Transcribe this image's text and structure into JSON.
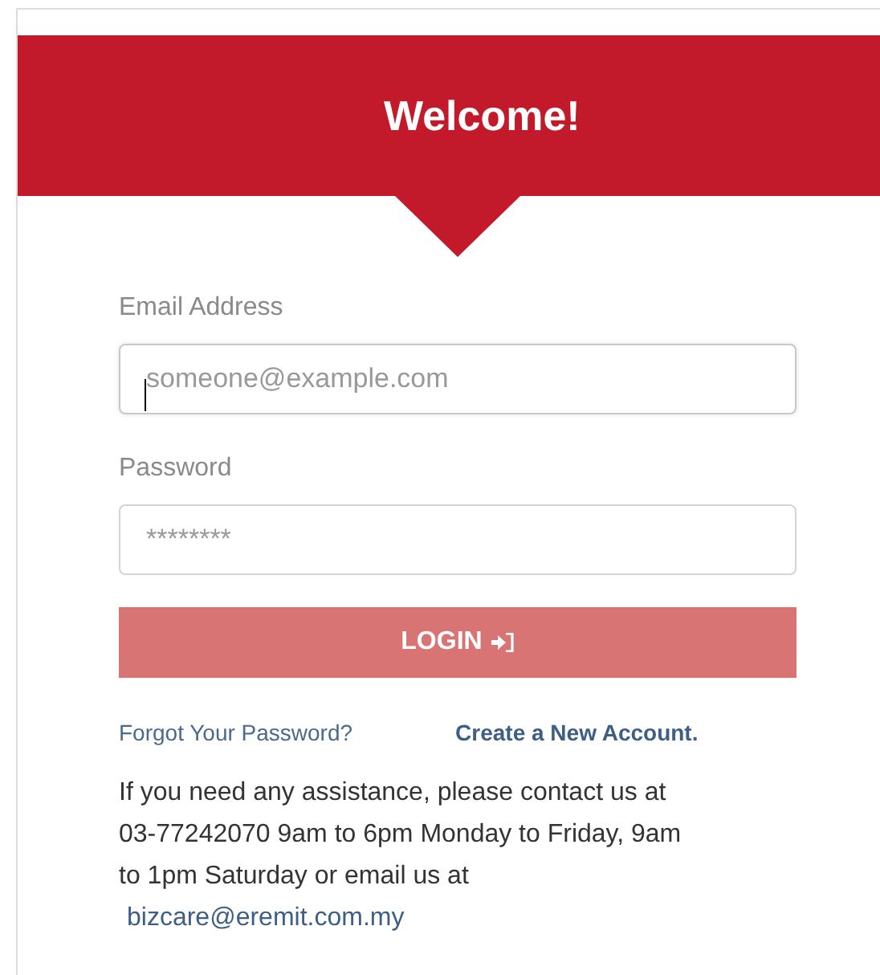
{
  "header": {
    "title": "Welcome!"
  },
  "fields": [
    {
      "label": "Email Address",
      "placeholder": "someone@example.com",
      "focused": true
    },
    {
      "label": "Password",
      "placeholder": "********",
      "focused": false
    }
  ],
  "login_button": {
    "label": "LOGIN"
  },
  "links": {
    "forgot": "Forgot Your Password?",
    "create": "Create a New Account."
  },
  "assistance": {
    "lines": [
      "If you need any assistance, please contact us at",
      "03-77242070 9am to 6pm Monday to Friday, 9am",
      "to 1pm Saturday or email us at"
    ],
    "email": "bizcare@eremit.com.my"
  }
}
